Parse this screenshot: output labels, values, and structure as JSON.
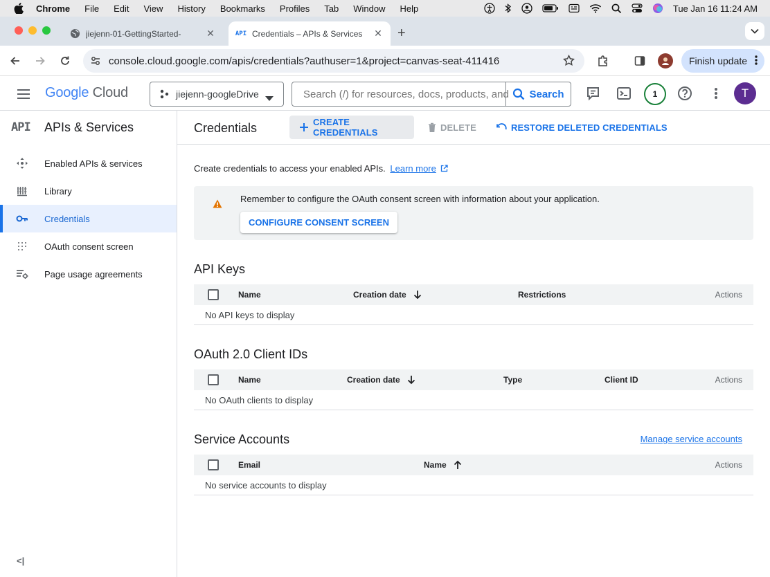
{
  "mac_menubar": {
    "app": "Chrome",
    "menus": [
      "File",
      "Edit",
      "View",
      "History",
      "Bookmarks",
      "Profiles",
      "Tab",
      "Window",
      "Help"
    ],
    "clock": "Tue Jan 16  11:24 AM"
  },
  "browser": {
    "tabs": [
      {
        "title": "jiejenn-01-GettingStarted-",
        "favicon": "globe-icon"
      },
      {
        "title": "Credentials – APIs & Services",
        "favicon": "api-icon"
      }
    ],
    "url": "console.cloud.google.com/apis/credentials?authuser=1&project=canvas-seat-411416",
    "finish_update": "Finish update"
  },
  "gcp_header": {
    "logo_google": "Google",
    "logo_cloud": "Cloud",
    "project": "jiejenn-googleDrive",
    "search_placeholder": "Search (/) for resources, docs, products, and more",
    "search_button": "Search",
    "notifications_count": "1",
    "avatar_letter": "T"
  },
  "sidebar": {
    "title": "APIs & Services",
    "api_badge": "API",
    "items": [
      {
        "label": "Enabled APIs & services",
        "icon": "diamond-arrows-icon"
      },
      {
        "label": "Library",
        "icon": "library-icon"
      },
      {
        "label": "Credentials",
        "icon": "key-icon",
        "active": true
      },
      {
        "label": "OAuth consent screen",
        "icon": "dots-grid-icon"
      },
      {
        "label": "Page usage agreements",
        "icon": "settings-list-icon"
      }
    ],
    "collapse_label": "<|"
  },
  "main": {
    "title": "Credentials",
    "actions": {
      "create": "CREATE CREDENTIALS",
      "delete": "DELETE",
      "restore": "RESTORE DELETED CREDENTIALS"
    },
    "intro_text": "Create credentials to access your enabled APIs.",
    "learn_more": "Learn more",
    "warning": {
      "message": "Remember to configure the OAuth consent screen with information about your application.",
      "button": "CONFIGURE CONSENT SCREEN"
    },
    "api_keys": {
      "title": "API Keys",
      "columns": [
        "Name",
        "Creation date",
        "Restrictions",
        "Actions"
      ],
      "empty": "No API keys to display"
    },
    "oauth": {
      "title": "OAuth 2.0 Client IDs",
      "columns": [
        "Name",
        "Creation date",
        "Type",
        "Client ID",
        "Actions"
      ],
      "empty": "No OAuth clients to display"
    },
    "service_accounts": {
      "title": "Service Accounts",
      "manage_link": "Manage service accounts",
      "columns": [
        "Email",
        "Name",
        "Actions"
      ],
      "empty": "No service accounts to display"
    }
  },
  "colors": {
    "accent_blue": "#1a73e8",
    "warning_orange": "#e37400",
    "active_bg": "#e8f0fe"
  }
}
